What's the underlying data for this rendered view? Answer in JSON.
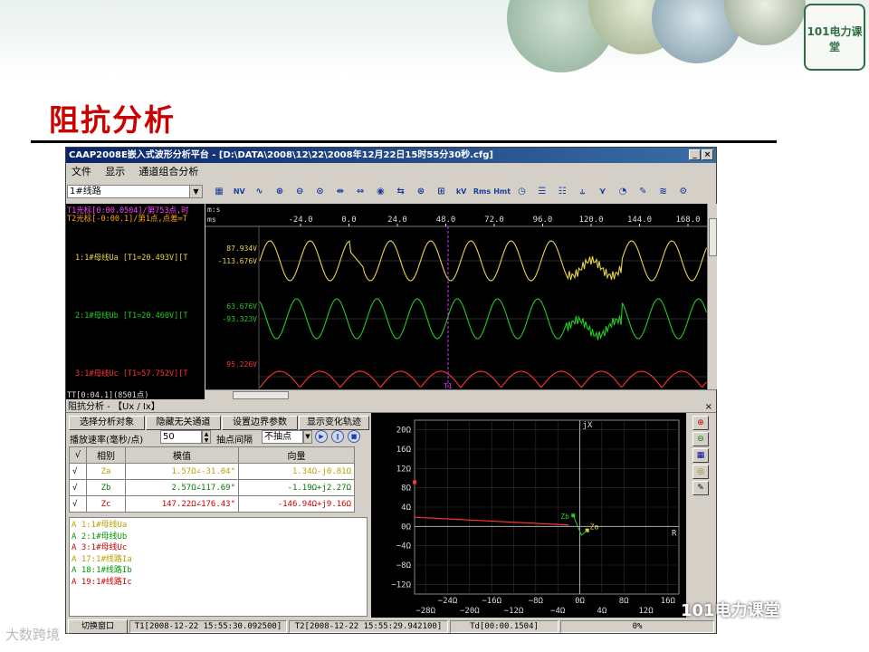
{
  "slide": {
    "title": "阻抗分析",
    "logo_text": "101电力课堂",
    "watermark": "101电力课堂",
    "watermark_bottom": "大数跨境"
  },
  "window": {
    "title": "CAAP2008E嵌入式波形分析平台 - [D:\\DATA\\2008\\12\\22\\2008年12月22日15时55分30秒.cfg]",
    "menu": [
      "文件",
      "显示",
      "通道组合分析"
    ],
    "channel_select": "1#线路",
    "toolbar_icons": [
      "channel-icon",
      "kv-icon",
      "wave-icon",
      "zoom-in-icon",
      "zoom-out-icon",
      "zoom-fit-icon",
      "expand-icon",
      "compress-icon",
      "zoom-x-icon",
      "swap-icon",
      "magnify-icon",
      "zoom-y-icon",
      "kv-text-icon",
      "rms-icon",
      "harmonic-icon",
      "clock-icon",
      "list-icon",
      "list2-icon",
      "phasor-icon",
      "fault-icon",
      "clock2-icon",
      "pen-icon",
      "wave2-icon",
      "settings-icon"
    ],
    "toolbar_kv": "kV",
    "toolbar_rms": "Rms",
    "toolbar_hmt": "Hmt",
    "toolbar_nv": "NV"
  },
  "waveform": {
    "cursor1": "T1光标[0:00.0504]/第753点,时",
    "cursor2": "T2光标[-0:00.1]/第1点,点差=T",
    "unit_row1": "m:s",
    "unit_row2": "ms",
    "time_ticks": [
      "-24.0",
      "0.0",
      "24.0",
      "48.0",
      "72.0",
      "96.0",
      "120.0",
      "144.0",
      "168.0"
    ],
    "cursor_label": "T1",
    "channels": [
      {
        "label": "1:1#母线Ua [T1=20.493V][T",
        "max": "87.934V",
        "min": "-113.676V",
        "color": "#e8d44a"
      },
      {
        "label": "2:1#母线Ub [T1=20.460V][T",
        "max": "63.676V",
        "min": "-93.323V",
        "color": "#22cc22"
      },
      {
        "label": "3:1#母线Uc [T1=57.752V][T",
        "max": "95.226V",
        "min": "",
        "color": "#ff3333"
      }
    ],
    "footer": "TT[0:04.1](8501点)"
  },
  "impedance": {
    "panel_title": "阻抗分析 - 【Ux / Ix】",
    "buttons": [
      "选择分析对象",
      "隐藏无关通道",
      "设置边界参数",
      "显示变化轨迹"
    ],
    "speed_label": "播放速率(毫秒/点)",
    "speed_value": "50",
    "sample_label": "抽点间隔",
    "sample_value": "不抽点",
    "table_headers": [
      "√",
      "相别",
      "模值",
      "向量"
    ],
    "rows": [
      {
        "check": "√",
        "phase": "Za",
        "magnitude": "1.57Ω∠-31.04°",
        "vector": "1.34Ω-j0.81Ω",
        "color": "#b8a000"
      },
      {
        "check": "√",
        "phase": "Zb",
        "magnitude": "2.57Ω∠117.69°",
        "vector": "-1.19Ω+j2.27Ω",
        "color": "#007a00"
      },
      {
        "check": "√",
        "phase": "Zc",
        "magnitude": "147.22Ω∠176.43°",
        "vector": "-146.94Ω+j9.16Ω",
        "color": "#cc0000"
      }
    ],
    "channel_list": [
      {
        "text": "A  1:1#母线Ua",
        "color": "#b8a000"
      },
      {
        "text": "A  2:1#母线Ub",
        "color": "#009900"
      },
      {
        "text": "A  3:1#母线Uc",
        "color": "#cc0000"
      },
      {
        "text": "A 17:1#线路Ia",
        "color": "#b8a000"
      },
      {
        "text": "A 18:1#线路Ib",
        "color": "#009900"
      },
      {
        "text": "A 19:1#线路Ic",
        "color": "#cc0000"
      }
    ],
    "plot": {
      "y_labels": [
        "20Ω",
        "16Ω",
        "12Ω",
        "8Ω",
        "4Ω",
        "0Ω",
        "−4Ω",
        "−8Ω",
        "−12Ω"
      ],
      "x_labels_top": [
        "−24Ω",
        "−16Ω",
        "−8Ω",
        "0Ω",
        "8Ω",
        "16Ω"
      ],
      "x_labels_bottom": [
        "−28Ω",
        "−20Ω",
        "−12Ω",
        "−4Ω",
        "4Ω",
        "12Ω"
      ],
      "axis_x": "jX",
      "axis_r": "R",
      "point_label_zb": "Zb",
      "point_label_za": "Za"
    }
  },
  "status": {
    "switch_button": "切换窗口",
    "t1": "T1[2008-12-22 15:55:30.092500]",
    "t2": "T2[2008-12-22 15:55:29.942100]",
    "td": "Td[00:00.1504]",
    "progress": "0%"
  },
  "chart_data": {
    "type": "scatter",
    "title": "",
    "xlabel": "R",
    "ylabel": "jX",
    "xlim": [
      -30,
      18
    ],
    "ylim": [
      -14,
      22
    ],
    "grid": true,
    "series": [
      {
        "name": "Za",
        "points": [
          [
            1.34,
            -0.81
          ]
        ],
        "color": "#e8d44a"
      },
      {
        "name": "Zb",
        "points": [
          [
            -1.19,
            2.27
          ]
        ],
        "color": "#22cc22"
      },
      {
        "name": "Zc",
        "points": [
          [
            -146.94,
            9.16
          ]
        ],
        "color": "#ff3333"
      }
    ]
  }
}
